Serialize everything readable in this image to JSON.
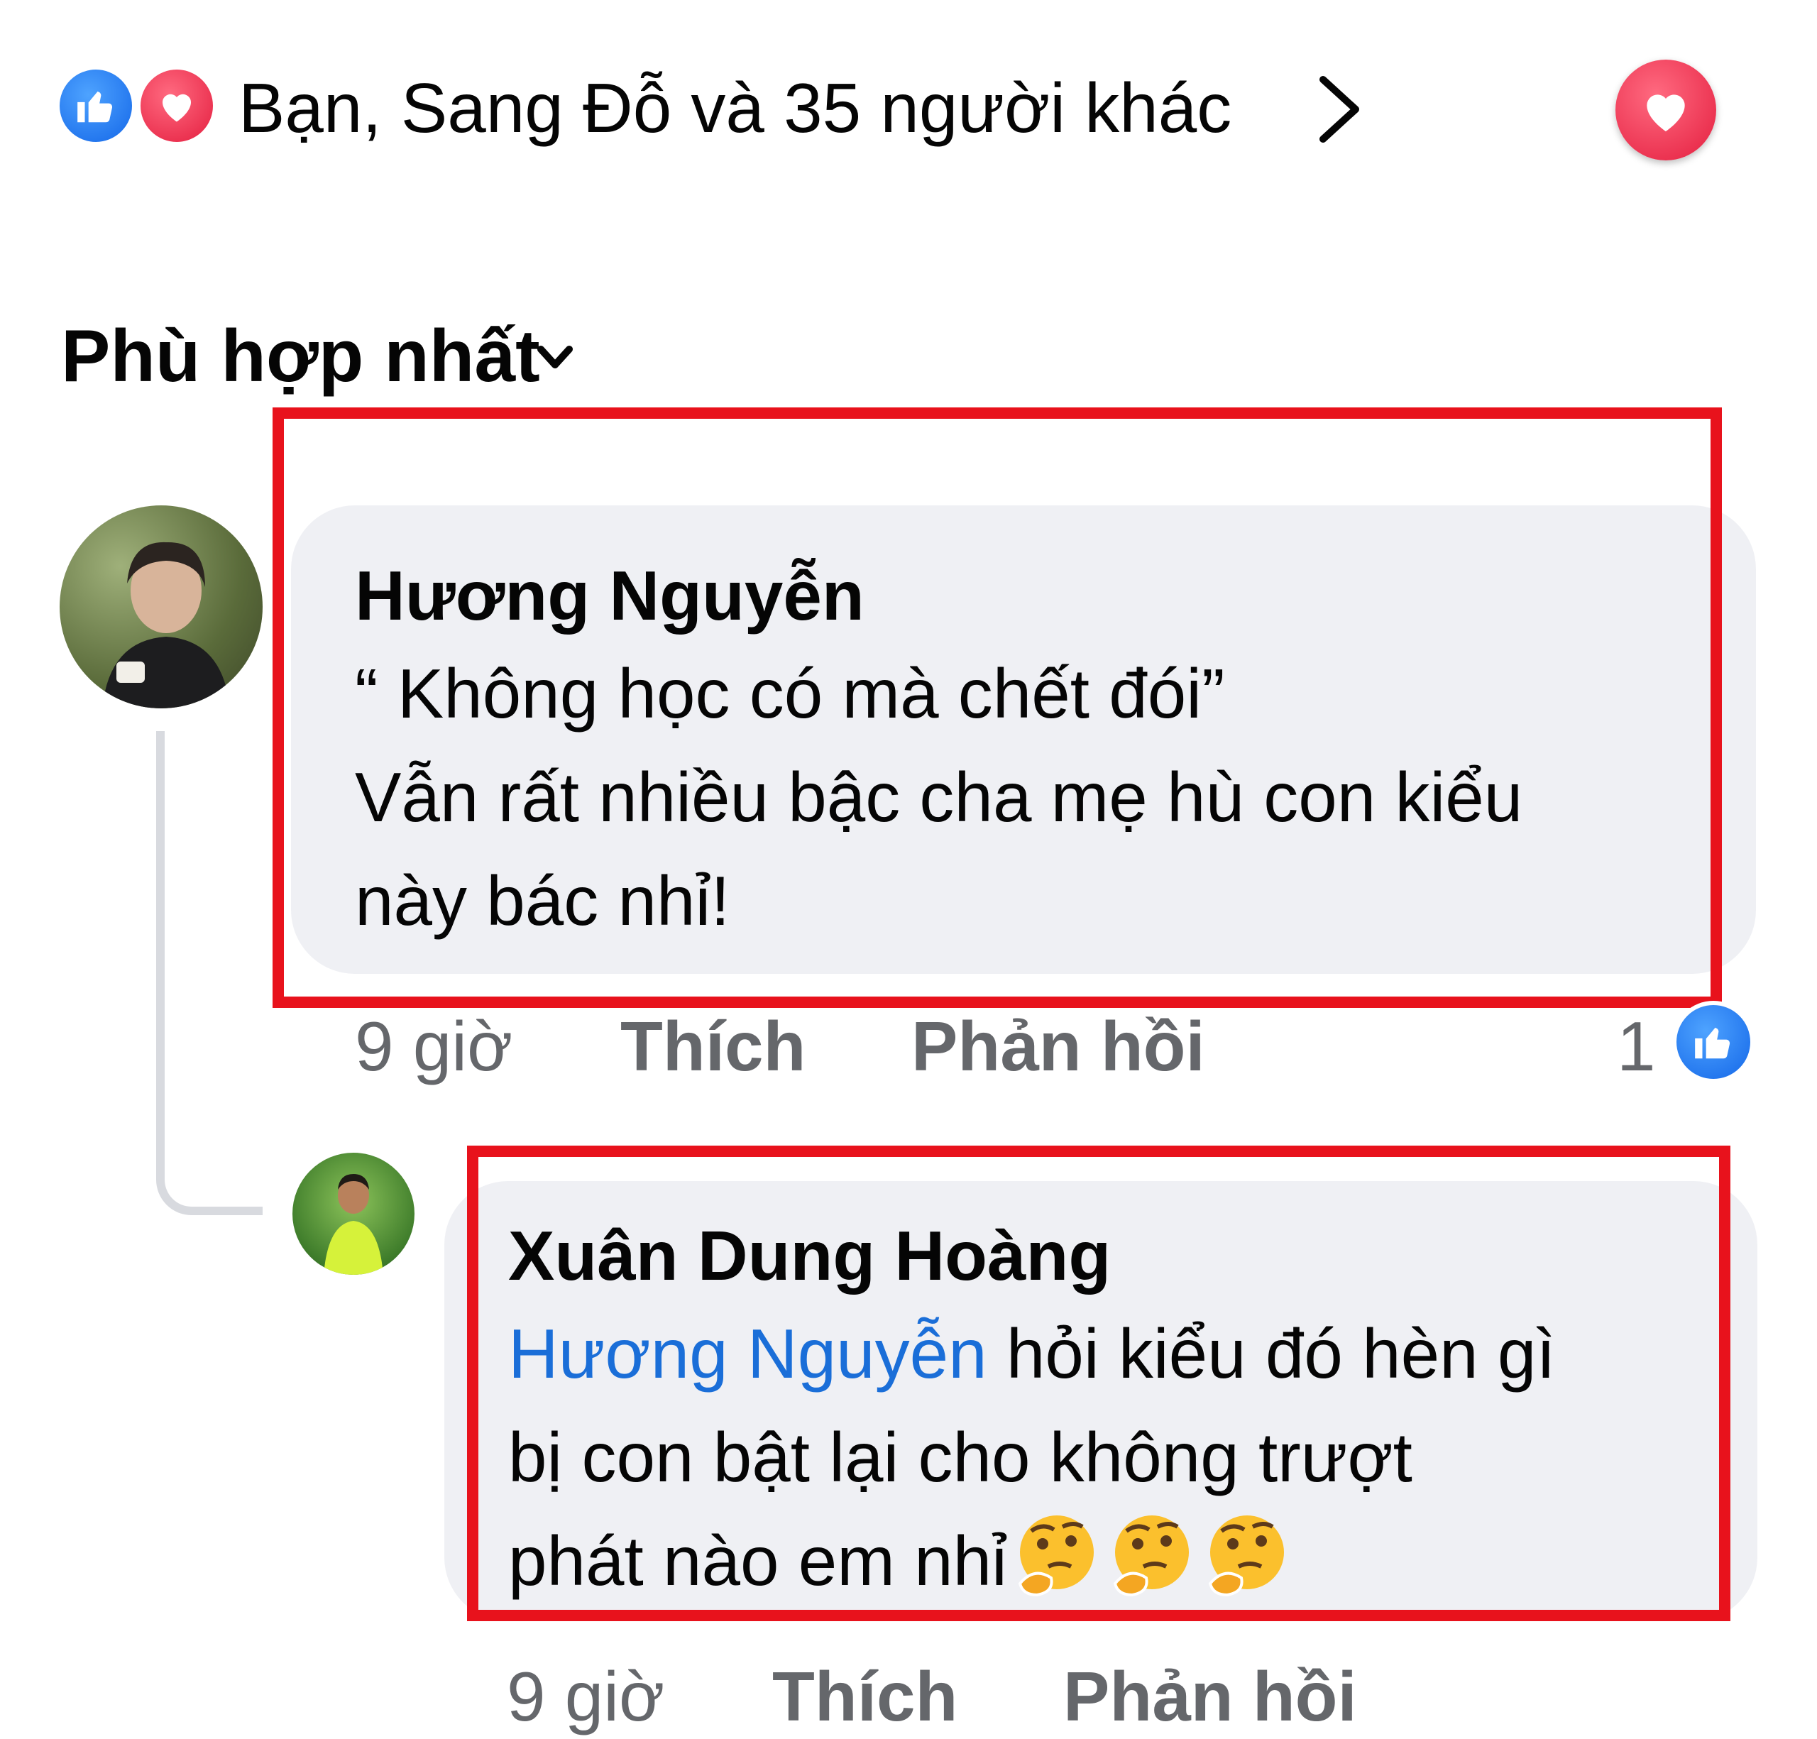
{
  "reactions": {
    "summary": "Bạn, Sang Đỗ và 35 người khác",
    "icons": [
      "like-icon",
      "love-icon"
    ],
    "chevron": "chevron-right-icon",
    "user_reaction": "love-icon"
  },
  "sort": {
    "label": "Phù hợp nhất",
    "icon": "chevron-down-icon"
  },
  "comments": [
    {
      "author": "Hương Nguyễn",
      "lines": [
        "“ Không học có mà chết đói”",
        "Vẫn rất nhiều bậc cha mẹ hù con kiểu",
        "này bác nhỉ!"
      ],
      "time": "9 giờ",
      "like_label": "Thích",
      "reply_label": "Phản hồi",
      "like_count": "1"
    },
    {
      "author": "Xuân Dung Hoàng",
      "mention": "Hương Nguyễn",
      "line1_rest": " hỏi kiểu đó hèn gì",
      "line2": "bị con bật lại cho không trượt",
      "line3": "phát nào em nhỉ",
      "emojis": [
        "thinking-face-icon",
        "thinking-face-icon",
        "thinking-face-icon"
      ],
      "time": "9 giờ",
      "like_label": "Thích",
      "reply_label": "Phản hồi"
    }
  ],
  "colors": {
    "highlight": "#e8121c",
    "bubble": "#eff0f4",
    "mention": "#1a6ed8",
    "meta": "#65676b",
    "like_blue": "#1467e8",
    "love_red": "#e41e3f"
  }
}
